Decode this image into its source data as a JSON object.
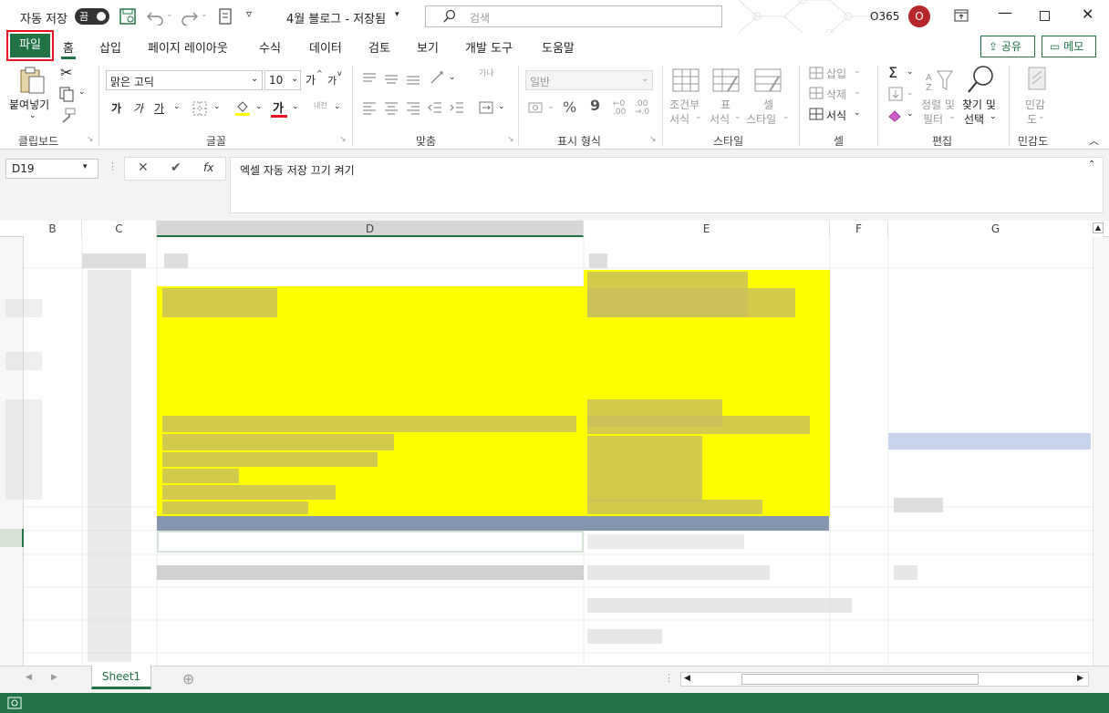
{
  "titlebar": {
    "autosave_label": "자동 저장",
    "autosave_state": "끔",
    "doc_title": "4월 블로그 - 저장됨",
    "search_placeholder": "검색",
    "account_label": "O365",
    "avatar_initial": "O"
  },
  "tabs": [
    "파일",
    "홈",
    "삽입",
    "페이지 레이아웃",
    "수식",
    "데이터",
    "검토",
    "보기",
    "개발 도구",
    "도움말"
  ],
  "tab_file": "파일",
  "share_label": "공유",
  "memo_label": "메모",
  "ribbon": {
    "clipboard": {
      "paste": "붙여넣기",
      "group": "클립보드"
    },
    "font": {
      "name": "맑은 고딕",
      "size": "10",
      "group": "글꼴",
      "bold": "가",
      "italic": "가",
      "underline": "가",
      "grow": "가",
      "shrink": "가",
      "fontcolor": "가",
      "phonetic": "내천"
    },
    "align": {
      "group": "맞춤",
      "wrap": "가나"
    },
    "number": {
      "format": "일반",
      "group": "표시 형식",
      "percent": "%",
      "comma": "9"
    },
    "styles": {
      "cond1": "조건부",
      "cond2": "서식",
      "table1": "표",
      "table2": "서식",
      "cell1": "셀",
      "cell2": "스타일",
      "group": "스타일"
    },
    "cells": {
      "insert": "삽입",
      "delete": "삭제",
      "format": "서식",
      "group": "셀"
    },
    "editing": {
      "sort1": "정렬 및",
      "sort2": "필터",
      "find1": "찾기 및",
      "find2": "선택",
      "group": "편집"
    },
    "sensitivity": {
      "l1": "민감",
      "l2": "도",
      "group": "민감도"
    }
  },
  "formula": {
    "namebox": "D19",
    "fx": "fx",
    "content": "엑셀 자동 저장 끄기 켜기"
  },
  "columns": [
    {
      "name": "B"
    },
    {
      "name": "C"
    },
    {
      "name": "D"
    },
    {
      "name": "E"
    },
    {
      "name": "F"
    },
    {
      "name": "G"
    }
  ],
  "sheet_tab": "Sheet1",
  "colors": {
    "excel_green": "#217346",
    "highlight": "#ffff00",
    "file_outline": "#e81123"
  }
}
